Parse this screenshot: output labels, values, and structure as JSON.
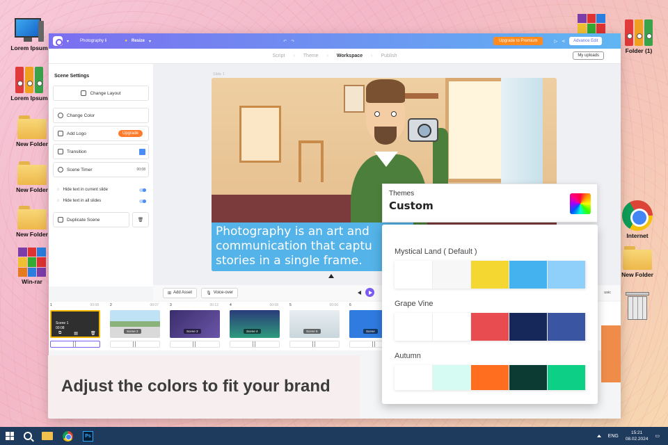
{
  "desktop": {
    "icons": [
      {
        "label": "Lorem Ipsum"
      },
      {
        "label": "Lorem Ipsum"
      },
      {
        "label": "New Folder"
      },
      {
        "label": "New Folder"
      },
      {
        "label": "New Folder"
      },
      {
        "label": "Win-rar"
      },
      {
        "label": "Folder (1)"
      },
      {
        "label": "Internet"
      },
      {
        "label": "New Folder"
      }
    ]
  },
  "app": {
    "topbar": {
      "project_name": "Photography li",
      "resize_label": "Resize",
      "upgrade_label": "Upgrade to Premium",
      "advance_edit_label": "Advance Edit"
    },
    "steps": {
      "items": [
        "Script",
        "Theme",
        "Workspace",
        "Publish"
      ],
      "active": "Workspace",
      "my_uploads_label": "My uploads"
    },
    "scene_settings": {
      "title": "Scene Settings",
      "change_layout": "Change Layout",
      "change_color": "Change Color",
      "add_logo": "Add Logo",
      "upgrade": "Upgrade",
      "transition": "Transition",
      "scene_timer": "Scene Timer",
      "timer_value": "00:08",
      "hide_current": "Hide text in current slide",
      "hide_all": "Hide text in all slides",
      "duplicate_scene": "Duplicate Scene"
    },
    "slide": {
      "label": "Slide 1",
      "caption_lines": [
        "Photography is an art and",
        "communication that captu",
        "stories in a single frame."
      ]
    },
    "asset_bar": {
      "add_asset": "Add Asset",
      "voice_over": "Voice-over",
      "music": "usic"
    },
    "timeline": {
      "scenes": [
        {
          "num": "1",
          "duration": "00:08",
          "title": "Scene 1",
          "time": "00:08"
        },
        {
          "num": "2",
          "duration": "00:07",
          "tag": "Scene 2"
        },
        {
          "num": "3",
          "duration": "00:12",
          "tag": "Scene 3"
        },
        {
          "num": "4",
          "duration": "00:08",
          "tag": "Scene 4"
        },
        {
          "num": "5",
          "duration": "00:06",
          "tag": "Scene 5"
        },
        {
          "num": "6",
          "duration": "",
          "tag": "Scene"
        }
      ]
    }
  },
  "banner": {
    "text": "Adjust the colors to fit your brand"
  },
  "themes": {
    "label": "Themes",
    "value": "Custom",
    "list": [
      {
        "name": "Mystical Land ( Default )",
        "colors": [
          "#ffffff",
          "#f7f7f7",
          "#f5d731",
          "#44b2ee",
          "#8fd0fa"
        ]
      },
      {
        "name": "Grape Vine",
        "colors": [
          "#ffffff",
          "#ffffff",
          "#e84c50",
          "#16275a",
          "#3a55a2"
        ]
      },
      {
        "name": "Autumn",
        "colors": [
          "#ffffff",
          "#d6fbf3",
          "#ff6e1f",
          "#0c3b33",
          "#0dcf86"
        ]
      }
    ]
  },
  "taskbar": {
    "lang": "ENG",
    "time": "15:21",
    "date": "08.02.2024",
    "ps_label": "Ps"
  }
}
